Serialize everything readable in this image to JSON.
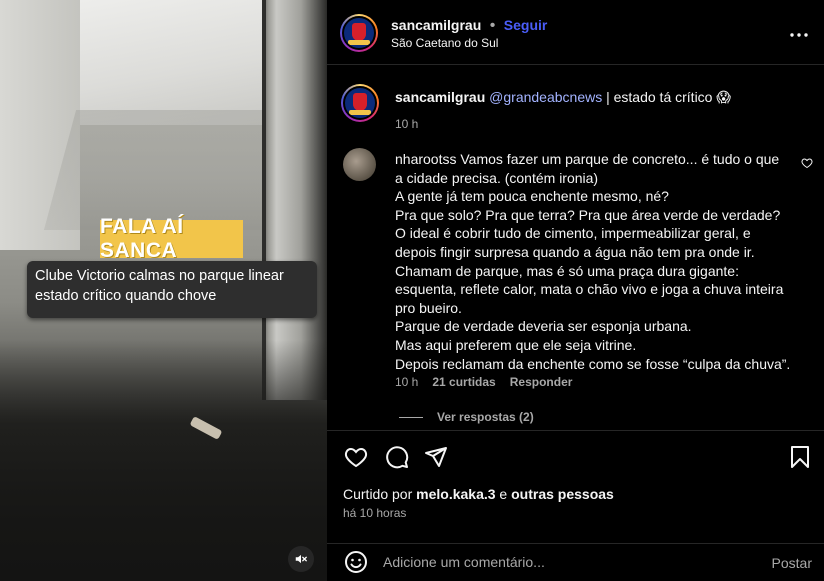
{
  "media": {
    "badge": "FALA AÍ SANCA",
    "caption": "Clube Victorio calmas no parque linear estado crítico quando chove",
    "mute_icon": "speaker-muted-icon"
  },
  "header": {
    "username": "sancamilgrau",
    "separator": "•",
    "follow_label": "Seguir",
    "location": "São Caetano do Sul",
    "more_icon": "more-horizontal-icon"
  },
  "post_caption": {
    "username": "sancamilgrau",
    "mention": "@grandeabcnews",
    "text": " | estado tá crítico 😱",
    "time": "10 h"
  },
  "comment": {
    "username": "nharootss",
    "lines": [
      "Vamos fazer um parque de concreto... é tudo o que",
      "a cidade precisa. (contém ironia)",
      "A gente já tem pouca enchente mesmo, né?",
      "Pra que solo? Pra que terra? Pra que área verde de verdade?",
      "O ideal é cobrir tudo de cimento, impermeabilizar geral, e",
      "depois fingir surpresa quando a água não tem pra onde ir.",
      "Chamam de parque, mas é só uma praça dura gigante:",
      "esquenta, reflete calor, mata o chão vivo e joga a chuva inteira",
      "pro bueiro.",
      "Parque de verdade deveria ser esponja urbana.",
      "Mas aqui preferem que ele seja vitrine.",
      "Depois reclamam da enchente como se fosse “culpa da chuva”."
    ],
    "time": "10 h",
    "likes": "21 curtidas",
    "reply_label": "Responder",
    "view_replies": "Ver respostas (2)"
  },
  "actions": {
    "liked_prefix": "Curtido por ",
    "liked_user": "melo.kaka.3",
    "liked_connector": " e ",
    "liked_others": "outras pessoas",
    "time_ago": "há 10 horas"
  },
  "comment_box": {
    "placeholder": "Adicione um comentário...",
    "post_label": "Postar"
  }
}
